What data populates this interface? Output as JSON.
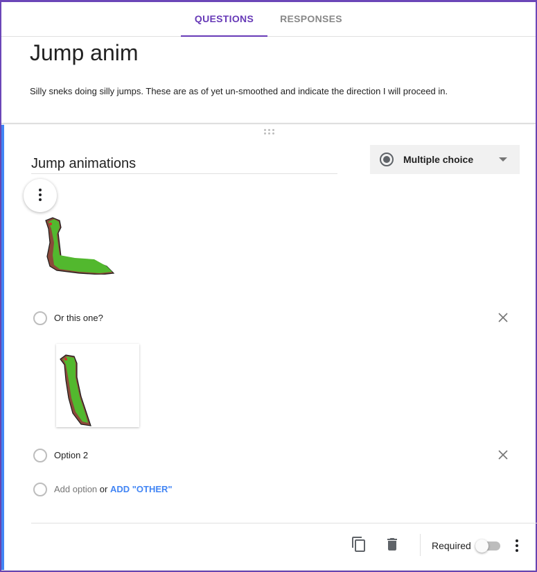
{
  "tabs": {
    "questions": "QUESTIONS",
    "responses": "RESPONSES"
  },
  "form": {
    "title": "Jump anim",
    "description": "Silly sneks doing silly jumps. These are as of yet un-smoothed and indicate the direction I will proceed in."
  },
  "question": {
    "title": "Jump animations",
    "type": "Multiple choice",
    "options": [
      {
        "label": "Or this one?"
      },
      {
        "label": "Option 2"
      }
    ],
    "add_option": "Add option",
    "or_text": "or",
    "add_other": "ADD \"OTHER\""
  },
  "footer": {
    "required_label": "Required",
    "required_on": false
  },
  "colors": {
    "accent": "#673ab7",
    "question_border": "#4285f4",
    "snake_green": "#52b82e",
    "snake_shadow": "#8a4a3a"
  }
}
